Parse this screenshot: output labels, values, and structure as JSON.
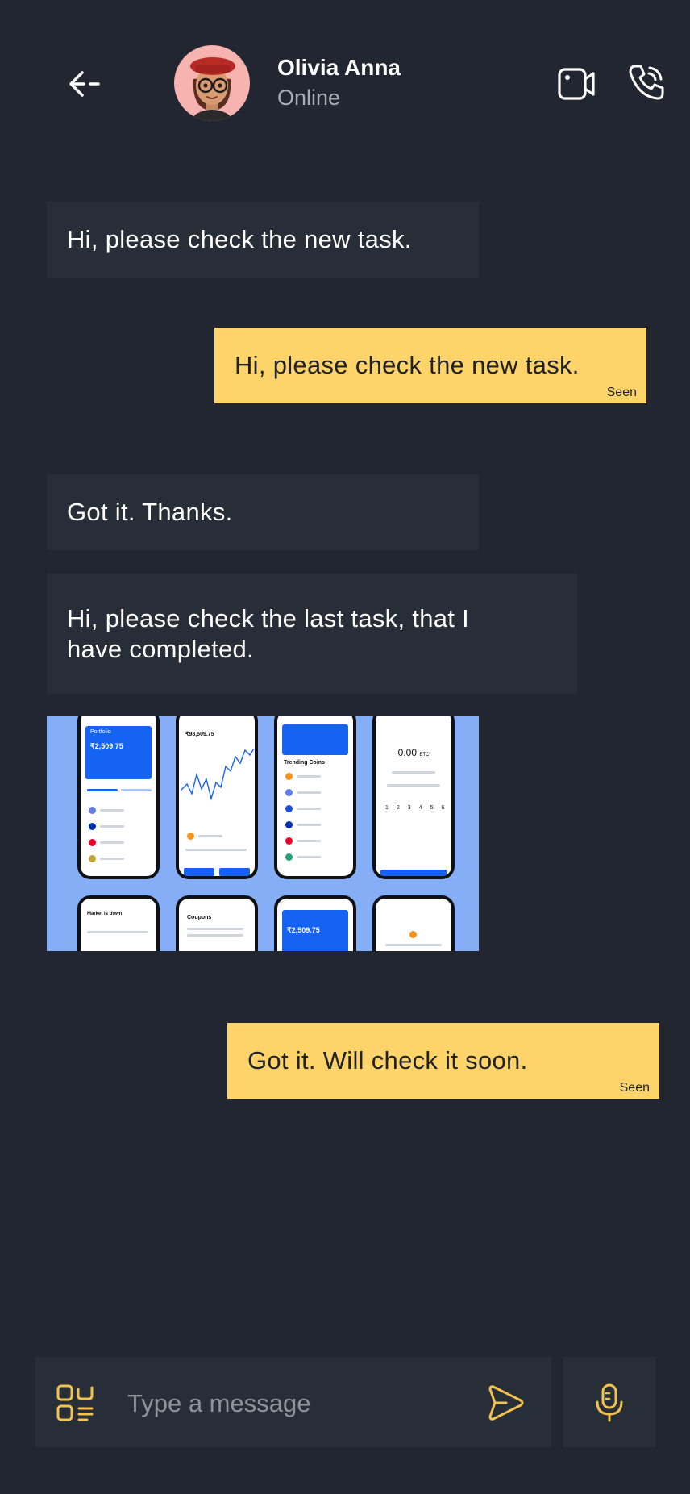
{
  "header": {
    "contact_name": "Olivia Anna",
    "status": "Online",
    "icons": {
      "back": "arrow-left-icon",
      "video": "video-camera-icon",
      "call": "phone-icon"
    }
  },
  "messages": [
    {
      "direction": "incoming",
      "text": "Hi, please check the new task."
    },
    {
      "direction": "outgoing",
      "text": "Hi, please check the new task.",
      "receipt": "Seen"
    },
    {
      "direction": "incoming",
      "text": "Got it. Thanks."
    },
    {
      "direction": "incoming",
      "text": "Hi, please check the last task, that I have completed."
    },
    {
      "direction": "incoming",
      "type": "image",
      "content": "crypto-app-screens"
    },
    {
      "direction": "outgoing",
      "text": "Got it. Will check it soon.",
      "receipt": "Seen"
    }
  ],
  "image_preview": {
    "portfolio_label": "Portfolio",
    "portfolio_value": "₹2,509.75",
    "coin_price": "₹98,509.75",
    "btc_amount": "0.00",
    "btc_unit": "BTC",
    "trending_label": "Trending Coins",
    "coupons_label": "Coupons",
    "market_label": "Market is down"
  },
  "composer": {
    "placeholder": "Type a message",
    "icons": {
      "apps": "apps-grid-icon",
      "send": "send-icon",
      "mic": "microphone-icon"
    }
  },
  "colors": {
    "background": "#212630",
    "incoming_bubble": "#282e37",
    "outgoing_bubble": "#fed46a",
    "accent": "#f2c14e"
  }
}
